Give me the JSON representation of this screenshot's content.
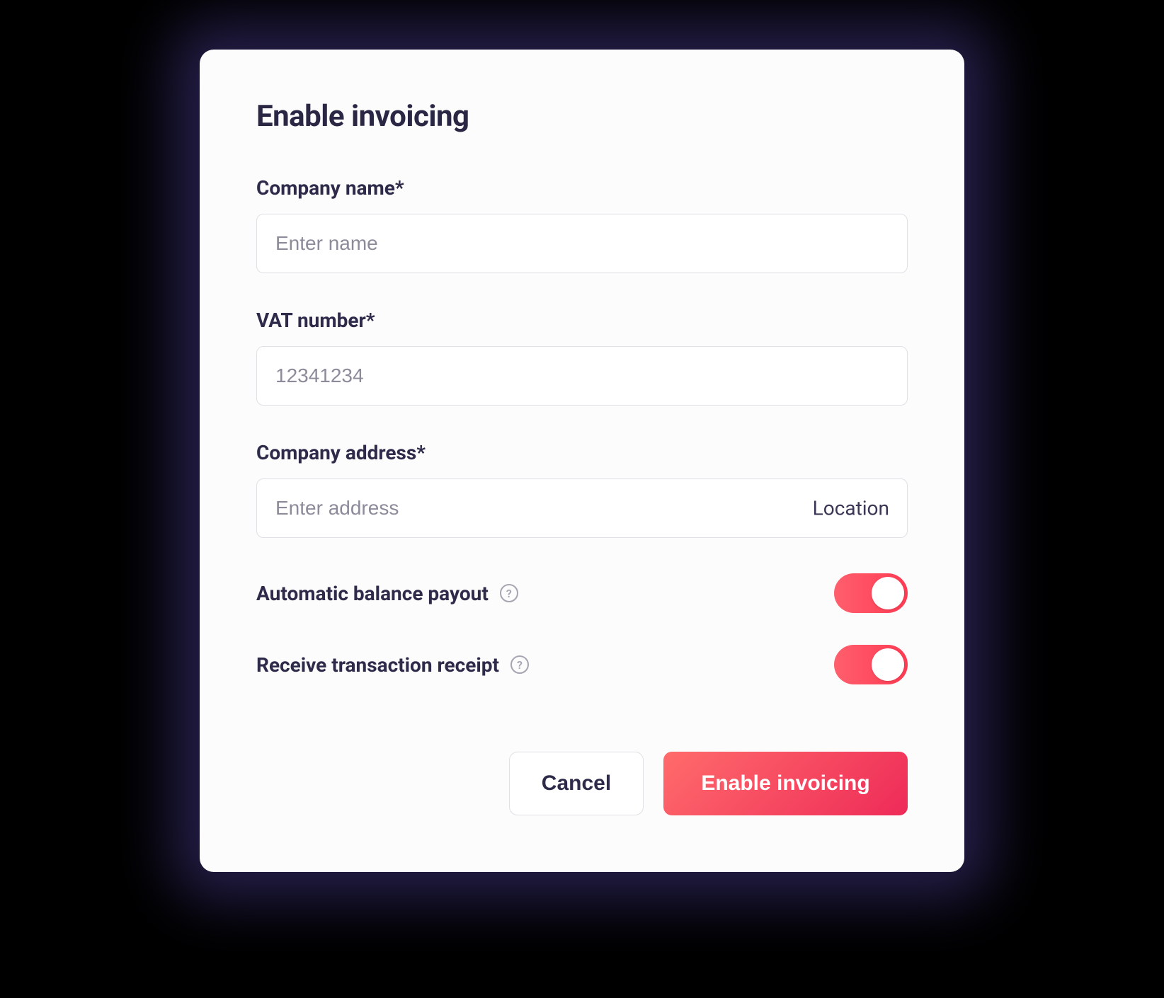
{
  "modal": {
    "title": "Enable invoicing",
    "fields": {
      "company_name": {
        "label": "Company name*",
        "placeholder": "Enter name",
        "value": ""
      },
      "vat_number": {
        "label": "VAT number*",
        "placeholder": "12341234",
        "value": ""
      },
      "company_address": {
        "label": "Company address*",
        "placeholder": "Enter address",
        "value": "",
        "suffix": "Location"
      }
    },
    "toggles": {
      "auto_payout": {
        "label": "Automatic balance payout",
        "enabled": true
      },
      "receive_receipt": {
        "label": "Receive transaction receipt",
        "enabled": true
      }
    },
    "buttons": {
      "cancel": "Cancel",
      "submit": "Enable invoicing"
    }
  }
}
